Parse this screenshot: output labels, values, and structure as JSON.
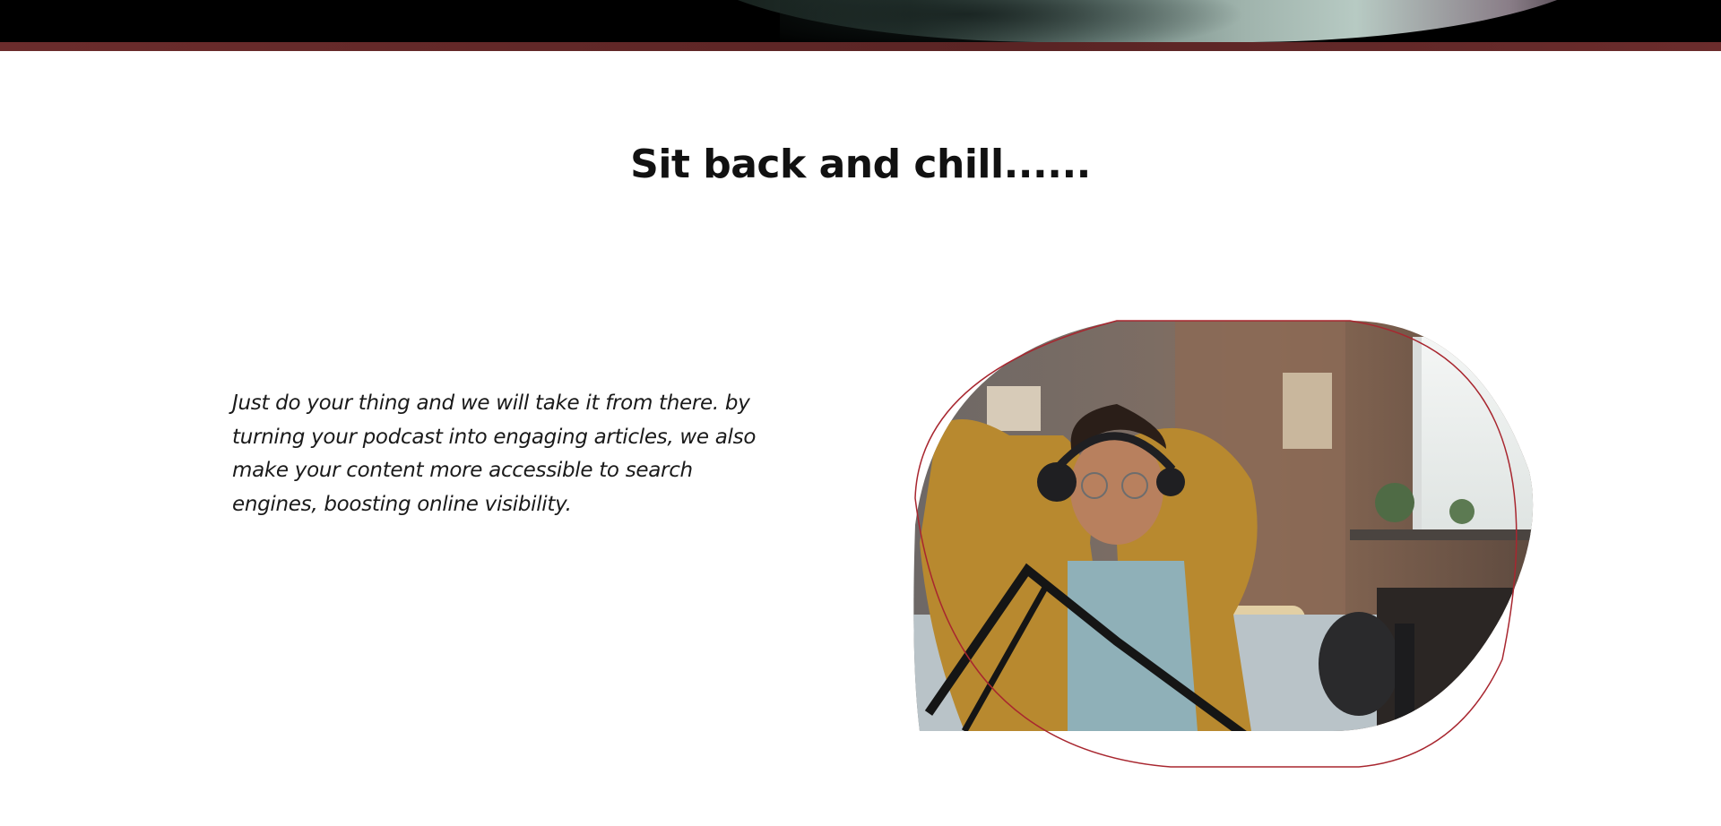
{
  "hero": {
    "accent_color": "#6b2c2c"
  },
  "section": {
    "title": "Sit back and chill......",
    "body": "Just do your thing and we will take it from there. by turning your podcast into engaging articles, we also make your content more accessible to search engines, boosting online visibility."
  },
  "image": {
    "outline_color": "#a8262f",
    "icon": "podcaster-relaxing-photo"
  }
}
